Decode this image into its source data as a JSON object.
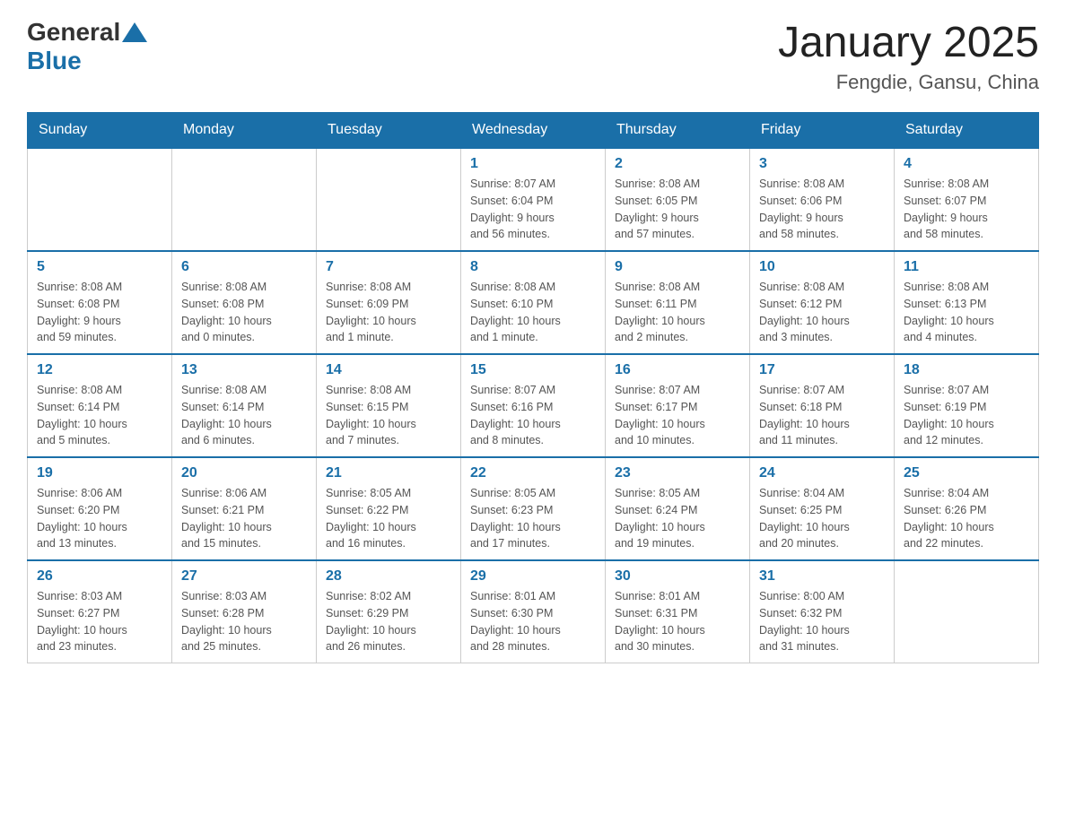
{
  "header": {
    "logo_general": "General",
    "logo_blue": "Blue",
    "title": "January 2025",
    "subtitle": "Fengdie, Gansu, China"
  },
  "days_of_week": [
    "Sunday",
    "Monday",
    "Tuesday",
    "Wednesday",
    "Thursday",
    "Friday",
    "Saturday"
  ],
  "weeks": [
    [
      {
        "day": "",
        "info": ""
      },
      {
        "day": "",
        "info": ""
      },
      {
        "day": "",
        "info": ""
      },
      {
        "day": "1",
        "info": "Sunrise: 8:07 AM\nSunset: 6:04 PM\nDaylight: 9 hours\nand 56 minutes."
      },
      {
        "day": "2",
        "info": "Sunrise: 8:08 AM\nSunset: 6:05 PM\nDaylight: 9 hours\nand 57 minutes."
      },
      {
        "day": "3",
        "info": "Sunrise: 8:08 AM\nSunset: 6:06 PM\nDaylight: 9 hours\nand 58 minutes."
      },
      {
        "day": "4",
        "info": "Sunrise: 8:08 AM\nSunset: 6:07 PM\nDaylight: 9 hours\nand 58 minutes."
      }
    ],
    [
      {
        "day": "5",
        "info": "Sunrise: 8:08 AM\nSunset: 6:08 PM\nDaylight: 9 hours\nand 59 minutes."
      },
      {
        "day": "6",
        "info": "Sunrise: 8:08 AM\nSunset: 6:08 PM\nDaylight: 10 hours\nand 0 minutes."
      },
      {
        "day": "7",
        "info": "Sunrise: 8:08 AM\nSunset: 6:09 PM\nDaylight: 10 hours\nand 1 minute."
      },
      {
        "day": "8",
        "info": "Sunrise: 8:08 AM\nSunset: 6:10 PM\nDaylight: 10 hours\nand 1 minute."
      },
      {
        "day": "9",
        "info": "Sunrise: 8:08 AM\nSunset: 6:11 PM\nDaylight: 10 hours\nand 2 minutes."
      },
      {
        "day": "10",
        "info": "Sunrise: 8:08 AM\nSunset: 6:12 PM\nDaylight: 10 hours\nand 3 minutes."
      },
      {
        "day": "11",
        "info": "Sunrise: 8:08 AM\nSunset: 6:13 PM\nDaylight: 10 hours\nand 4 minutes."
      }
    ],
    [
      {
        "day": "12",
        "info": "Sunrise: 8:08 AM\nSunset: 6:14 PM\nDaylight: 10 hours\nand 5 minutes."
      },
      {
        "day": "13",
        "info": "Sunrise: 8:08 AM\nSunset: 6:14 PM\nDaylight: 10 hours\nand 6 minutes."
      },
      {
        "day": "14",
        "info": "Sunrise: 8:08 AM\nSunset: 6:15 PM\nDaylight: 10 hours\nand 7 minutes."
      },
      {
        "day": "15",
        "info": "Sunrise: 8:07 AM\nSunset: 6:16 PM\nDaylight: 10 hours\nand 8 minutes."
      },
      {
        "day": "16",
        "info": "Sunrise: 8:07 AM\nSunset: 6:17 PM\nDaylight: 10 hours\nand 10 minutes."
      },
      {
        "day": "17",
        "info": "Sunrise: 8:07 AM\nSunset: 6:18 PM\nDaylight: 10 hours\nand 11 minutes."
      },
      {
        "day": "18",
        "info": "Sunrise: 8:07 AM\nSunset: 6:19 PM\nDaylight: 10 hours\nand 12 minutes."
      }
    ],
    [
      {
        "day": "19",
        "info": "Sunrise: 8:06 AM\nSunset: 6:20 PM\nDaylight: 10 hours\nand 13 minutes."
      },
      {
        "day": "20",
        "info": "Sunrise: 8:06 AM\nSunset: 6:21 PM\nDaylight: 10 hours\nand 15 minutes."
      },
      {
        "day": "21",
        "info": "Sunrise: 8:05 AM\nSunset: 6:22 PM\nDaylight: 10 hours\nand 16 minutes."
      },
      {
        "day": "22",
        "info": "Sunrise: 8:05 AM\nSunset: 6:23 PM\nDaylight: 10 hours\nand 17 minutes."
      },
      {
        "day": "23",
        "info": "Sunrise: 8:05 AM\nSunset: 6:24 PM\nDaylight: 10 hours\nand 19 minutes."
      },
      {
        "day": "24",
        "info": "Sunrise: 8:04 AM\nSunset: 6:25 PM\nDaylight: 10 hours\nand 20 minutes."
      },
      {
        "day": "25",
        "info": "Sunrise: 8:04 AM\nSunset: 6:26 PM\nDaylight: 10 hours\nand 22 minutes."
      }
    ],
    [
      {
        "day": "26",
        "info": "Sunrise: 8:03 AM\nSunset: 6:27 PM\nDaylight: 10 hours\nand 23 minutes."
      },
      {
        "day": "27",
        "info": "Sunrise: 8:03 AM\nSunset: 6:28 PM\nDaylight: 10 hours\nand 25 minutes."
      },
      {
        "day": "28",
        "info": "Sunrise: 8:02 AM\nSunset: 6:29 PM\nDaylight: 10 hours\nand 26 minutes."
      },
      {
        "day": "29",
        "info": "Sunrise: 8:01 AM\nSunset: 6:30 PM\nDaylight: 10 hours\nand 28 minutes."
      },
      {
        "day": "30",
        "info": "Sunrise: 8:01 AM\nSunset: 6:31 PM\nDaylight: 10 hours\nand 30 minutes."
      },
      {
        "day": "31",
        "info": "Sunrise: 8:00 AM\nSunset: 6:32 PM\nDaylight: 10 hours\nand 31 minutes."
      },
      {
        "day": "",
        "info": ""
      }
    ]
  ]
}
